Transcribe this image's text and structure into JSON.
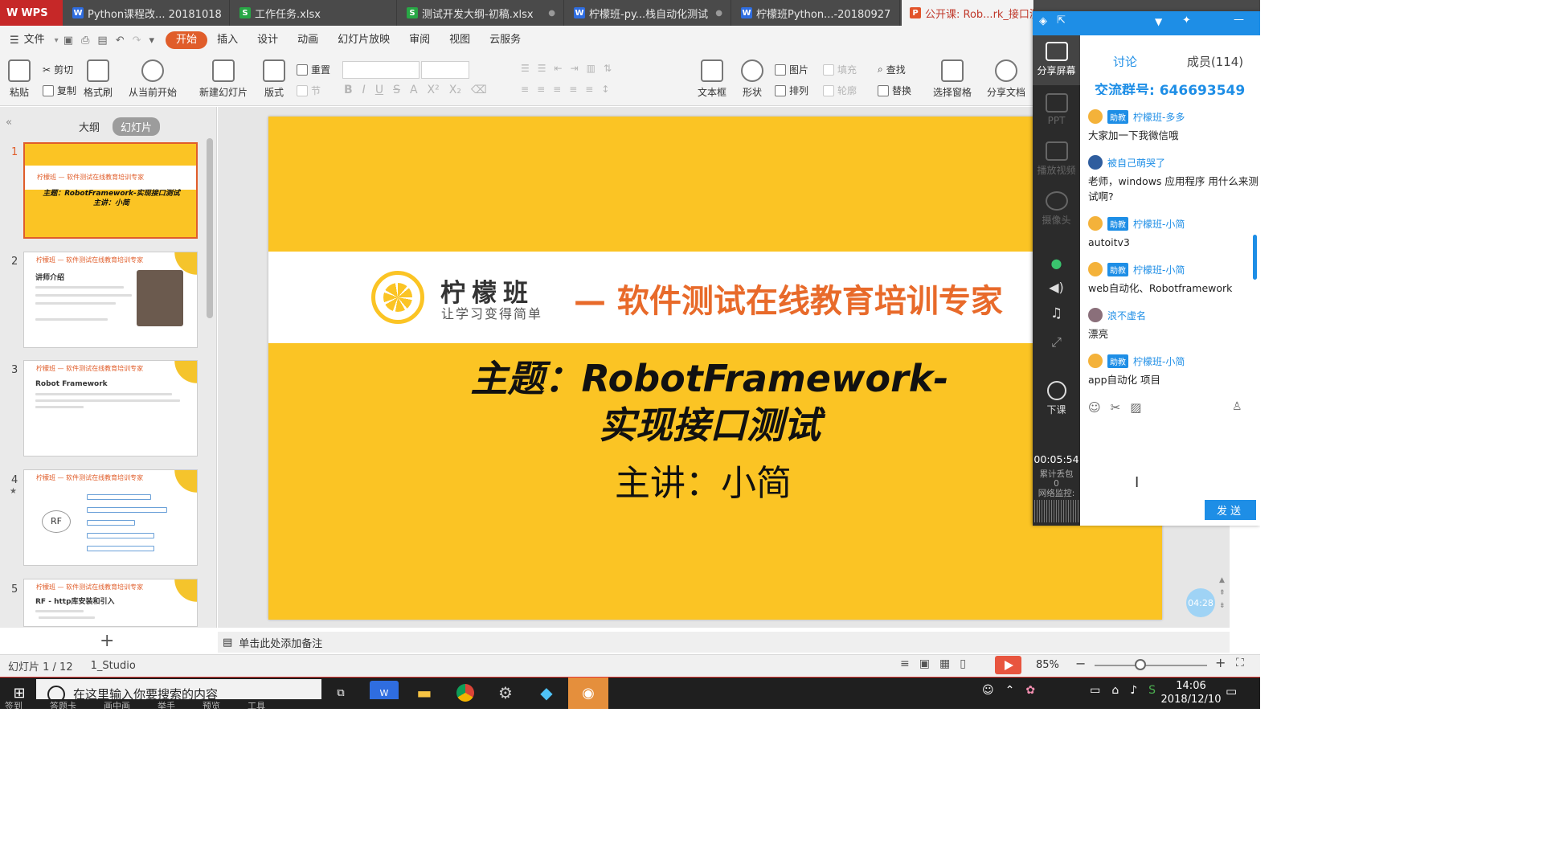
{
  "wps_label": "WPS",
  "tabs": [
    {
      "label": "Python课程改... 20181018",
      "icon": "W"
    },
    {
      "label": "工作任务.xlsx",
      "icon": "S"
    },
    {
      "label": "测试开发大纲-初稿.xlsx",
      "icon": "S"
    },
    {
      "label": "柠檬班-py...栈自动化测试",
      "icon": "W"
    },
    {
      "label": "柠檬班Python...-20180927",
      "icon": "W"
    },
    {
      "label": "公开课: Rob...rk_接口测",
      "icon": "P"
    }
  ],
  "menu": {
    "file": "文件",
    "items": [
      "开始",
      "插入",
      "设计",
      "动画",
      "幻灯片放映",
      "审阅",
      "视图",
      "云服务"
    ]
  },
  "ribbon": {
    "paste": "粘贴",
    "cut": "剪切",
    "copy": "复制",
    "format_painter": "格式刷",
    "from_current": "从当前开始",
    "new_slide": "新建幻灯片",
    "layout": "版式",
    "reset": "重置",
    "section": "节",
    "textbox": "文本框",
    "shape": "形状",
    "picture": "图片",
    "fill": "填充",
    "arrange": "排列",
    "outline": "轮廓",
    "find": "查找",
    "replace": "替换",
    "select_pane": "选择窗格",
    "share_doc": "分享文档"
  },
  "left_panel": {
    "outline_tab": "大纲",
    "slides_tab": "幻灯片",
    "thumbnails": [
      {
        "num": "1",
        "head": "柠檬班 — 软件测试在线教育培训专家",
        "title": "主题：RobotFramework-实现接口测试 主讲：小简"
      },
      {
        "num": "2",
        "head": "柠檬班 — 软件测试在线教育培训专家",
        "title": "讲师介绍"
      },
      {
        "num": "3",
        "head": "柠檬班 — 软件测试在线教育培训专家",
        "title": "Robot Framework"
      },
      {
        "num": "4",
        "head": "柠檬班 — 软件测试在线教育培训专家",
        "title": "RF"
      },
      {
        "num": "5",
        "head": "柠檬班 — 软件测试在线教育培训专家",
        "title": "RF - http库安装和引入"
      }
    ]
  },
  "slide": {
    "brand": "柠檬班",
    "brand_sub": "让学习变得简单",
    "slogan": "— 软件测试在线教育培训专家",
    "topic_line1": "主题：RobotFramework-",
    "topic_line2": "实现接口测试",
    "speaker": "主讲：小简"
  },
  "notes_placeholder": "单击此处添加备注",
  "status": {
    "slide_counter": "幻灯片 1 / 12",
    "theme": "1_Studio",
    "zoom": "85%"
  },
  "taskbar": {
    "search_placeholder": "在这里输入你要搜索的内容",
    "time": "14:06",
    "date": "2018/12/10",
    "strip": [
      "签到",
      "答题卡",
      "画中画",
      "举手",
      "预览",
      "工具"
    ]
  },
  "live": {
    "share_screen": "分享屏幕",
    "ppt": "PPT",
    "play_video": "播放视频",
    "camera": "摄像头",
    "end_class": "下课",
    "timer": "00:05:54",
    "lost_packets_label": "累计丢包",
    "lost_packets": "0",
    "net_monitor": "网络监控:",
    "tab_discuss": "讨论",
    "tab_members": "成员(114)",
    "group_number": "交流群号: 646693549",
    "float_time": "04:28",
    "send": "发送",
    "messages": [
      {
        "user": "柠檬班-多多",
        "badge": "助教",
        "text": "大家加一下我微信哦"
      },
      {
        "user": "被自己萌哭了",
        "badge": "",
        "text": "老师，windows 应用程序 用什么来测试啊?"
      },
      {
        "user": "柠檬班-小简",
        "badge": "助教",
        "text": "autoitv3"
      },
      {
        "user": "柠檬班-小简",
        "badge": "助教",
        "text": "web自动化、Robotframework"
      },
      {
        "user": "浪不虚名",
        "badge": "",
        "text": "漂亮"
      },
      {
        "user": "柠檬班-小简",
        "badge": "助教",
        "text": "app自动化 项目"
      }
    ]
  }
}
